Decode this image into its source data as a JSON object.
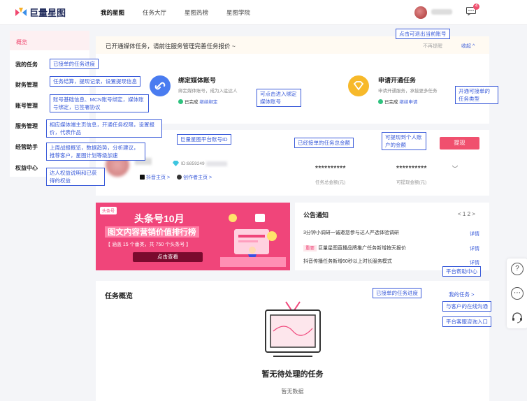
{
  "brand": {
    "name": "巨量星图"
  },
  "nav": [
    "我的星图",
    "任务大厅",
    "星图热榜",
    "星图学院"
  ],
  "header": {
    "badge_count": "4"
  },
  "sidebar": {
    "items": [
      "概览",
      "我的任务",
      "财务管理",
      "账号管理",
      "服务管理",
      "经营助手",
      "权益中心"
    ]
  },
  "notice_strip": {
    "text": "已开通媒体任务，请前往服务管理完善任务报价 ~",
    "dismiss": "不再提醒",
    "collapse": "收起 ^"
  },
  "steps": [
    {
      "title": "绑定媒体账号",
      "sub": "绑定媒体账号，成为入驻达人",
      "status": "已完成",
      "link": "继续绑定"
    },
    {
      "title": "申请开通任务",
      "sub": "申请开通服务，承接更多任务",
      "status": "已完成",
      "link": "继续申请"
    }
  ],
  "account": {
    "id_prefix": "ID:6859249",
    "douyin_home": "抖音主页 >",
    "creator_home": "创作者主页 >",
    "total_stars": "**********",
    "total_label": "任务总金额(元)",
    "withdraw_stars": "**********",
    "withdraw_label": "可提现金额(元)",
    "withdraw_button": "提现"
  },
  "promo": {
    "tag": "头条号",
    "title": "头条号10月",
    "subtitle": "图文内容营销价值排行榜",
    "desc": "【 涵盖 15 个垂类，共 750 个头条号 】",
    "cta": "点击查看"
  },
  "notices": {
    "title": "公告通知",
    "pager": "< 1 2 >",
    "rows": [
      {
        "text": "3分钟小调研一诚邀您参与达人严选体验调研",
        "detail": "详情"
      },
      {
        "tag": "重要",
        "text": "巨量星图直播品牌推广任务新增按天报价",
        "detail": "详情"
      },
      {
        "text": "抖音传播任务新增60秒以上时长服务模式",
        "detail": "详情"
      }
    ]
  },
  "task_overview": {
    "title": "任务概览",
    "mine": "我的任务 >",
    "empty_title": "暂无待处理的任务",
    "empty_sub": "暂无数据"
  },
  "callouts": [
    "点击可退出当前账号",
    "已接单的任务进度",
    "任务结算，提现记录，设置提现信息",
    "账号基础信息、MCN账号绑定，媒体账号绑定，已签署协议",
    "相应媒体端主页信息，开通任务权限，设置报价，代表作品",
    "上周战报概览，数据趋势，分析建议，推荐客户，星图计划等级加速",
    "达人权益说明和已获得的权益",
    "可点击进入绑定媒体账号",
    "开通可接单的任务类型",
    "巨量星图平台账号ID",
    "已经接单的任务总金额",
    "可提现到个人账户的金额",
    "平台帮助中心",
    "已接单的任务进度",
    "与客户的在线沟通",
    "平台客服咨询入口"
  ],
  "colors": {
    "accent": "#f0506e",
    "link": "#3a5bd9",
    "promo": "#f0457a"
  }
}
